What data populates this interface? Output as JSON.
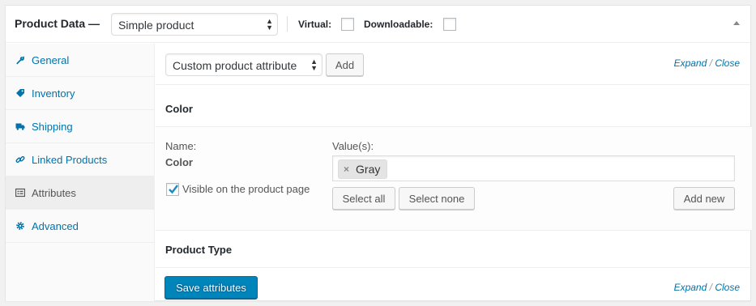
{
  "header": {
    "title": "Product Data —",
    "product_type": "Simple product",
    "virtual_label": "Virtual:",
    "downloadable_label": "Downloadable:"
  },
  "sidebar": {
    "items": [
      {
        "label": "General",
        "icon": "wrench-icon"
      },
      {
        "label": "Inventory",
        "icon": "tag-icon"
      },
      {
        "label": "Shipping",
        "icon": "truck-icon"
      },
      {
        "label": "Linked Products",
        "icon": "link-icon"
      },
      {
        "label": "Attributes",
        "icon": "list-icon",
        "active": true
      },
      {
        "label": "Advanced",
        "icon": "gear-icon"
      }
    ]
  },
  "toolbar": {
    "attribute_select": "Custom product attribute",
    "add_label": "Add",
    "expand": "Expand",
    "slash": "/",
    "close": "Close"
  },
  "attributes": [
    {
      "title": "Color",
      "name_label": "Name:",
      "name_value": "Color",
      "visible_label": "Visible on the product page",
      "visible_checked": true,
      "values_label": "Value(s):",
      "values": [
        "Gray"
      ],
      "select_all": "Select all",
      "select_none": "Select none",
      "add_new": "Add new"
    },
    {
      "title": "Product Type"
    }
  ],
  "footer": {
    "save_label": "Save attributes",
    "expand": "Expand",
    "slash": "/",
    "close": "Close"
  },
  "colors": {
    "link": "#0073aa",
    "primary": "#0085ba"
  }
}
